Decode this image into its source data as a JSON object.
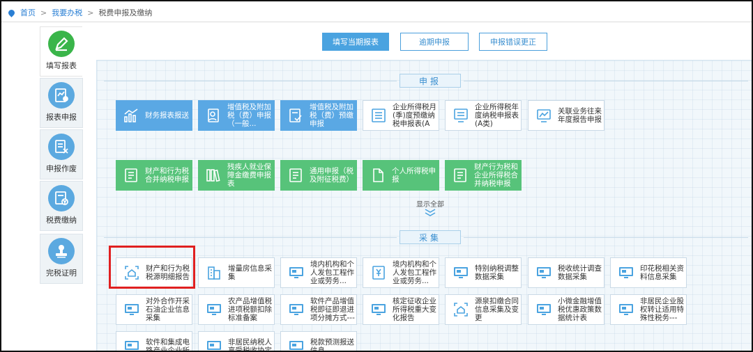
{
  "breadcrumb": {
    "home": "首页",
    "do_tax": "我要办税",
    "current": "税费申报及缴纳",
    "sep": ">"
  },
  "sidebar": [
    {
      "label": "填写报表",
      "icon": "pencil-icon",
      "active": true,
      "color": "#3ab54a"
    },
    {
      "label": "报表申报",
      "icon": "report-upload-icon",
      "active": false,
      "color": "#5ba9e0"
    },
    {
      "label": "申报作废",
      "icon": "doc-cancel-icon",
      "active": false,
      "color": "#5ba9e0"
    },
    {
      "label": "税费缴纳",
      "icon": "tax-payment-icon",
      "active": false,
      "color": "#5ba9e0"
    },
    {
      "label": "完税证明",
      "icon": "stamp-icon",
      "active": false,
      "color": "#5ba9e0"
    }
  ],
  "tabs": [
    {
      "label": "填写当期报表",
      "active": true
    },
    {
      "label": "逾期申报",
      "active": false
    },
    {
      "label": "申报错误更正",
      "active": false
    }
  ],
  "declare": {
    "title": "申报",
    "row1": [
      {
        "label": "财务报表报送",
        "icon": "bar-chart-icon",
        "style": "blue"
      },
      {
        "label": "增值税及附加税（费）申报（一般...",
        "icon": "person-form-icon",
        "style": "blue"
      },
      {
        "label": "增值税及附加税（费）预缴申报",
        "icon": "form-check-icon",
        "style": "blue"
      },
      {
        "label": "企业所得税月(季)度预缴纳税申报表(A类)",
        "icon": "list-icon",
        "style": "white"
      },
      {
        "label": "企业所得税年度纳税申报表(A类)",
        "icon": "monitor-doc-icon",
        "style": "white"
      },
      {
        "label": "关联业务往来年度报告申报",
        "icon": "monitor-chart-icon",
        "style": "white"
      }
    ],
    "row2": [
      {
        "label": "财产和行为税合并纳税申报",
        "icon": "document-icon",
        "style": "green"
      },
      {
        "label": "残疾人就业保障金缴费申报表",
        "icon": "books-icon",
        "style": "green"
      },
      {
        "label": "通用申报（税及附征税费）",
        "icon": "document-icon",
        "style": "green"
      },
      {
        "label": "个人所得税申报",
        "icon": "file-icon",
        "style": "green"
      },
      {
        "label": "财产行为税和企业所得税合并纳税申报",
        "icon": "document-icon",
        "style": "green"
      }
    ],
    "show_all": "显示全部"
  },
  "collect": {
    "title": "采集",
    "row1": [
      {
        "label": "财产和行为税税源明细报告",
        "icon": "house-scan-icon"
      },
      {
        "label": "增量房信息采集",
        "icon": "building-icon"
      },
      {
        "label": "境内机构和个人发包工程作业或劳务...",
        "icon": "monitor-icon"
      },
      {
        "label": "境内机构和个人发包工程作业或劳务...",
        "icon": "yuan-doc-icon"
      },
      {
        "label": "特别纳税调整数据采集",
        "icon": "monitor-icon"
      },
      {
        "label": "税收统计调查数据采集",
        "icon": "monitor-icon"
      },
      {
        "label": "印花税相关资料信息采集",
        "icon": "monitor-icon"
      }
    ],
    "row2": [
      {
        "label": "对外合作开采石油企业信息采集",
        "icon": "monitor-icon"
      },
      {
        "label": "农产品增值税进项税额扣除标准备案",
        "icon": "monitor-icon"
      },
      {
        "label": "软件产品增值税即征即退进项分摊方式---",
        "icon": "monitor-icon"
      },
      {
        "label": "核定征收企业所得税重大变化报告",
        "icon": "monitor-icon"
      },
      {
        "label": "源泉扣缴合同信息采集及变更",
        "icon": "house-scan-icon"
      },
      {
        "label": "小微金融增值税优惠政策数据统计表",
        "icon": "monitor-icon"
      },
      {
        "label": "非居民企业股权转让适用特殊性税务---",
        "icon": "monitor-icon"
      }
    ],
    "row3": [
      {
        "label": "软件和集成电路产业企业所",
        "icon": "monitor-icon"
      },
      {
        "label": "非居民纳税人享受税收协定",
        "icon": "monitor-icon"
      },
      {
        "label": "税款预测报送信息",
        "icon": "monitor-icon"
      }
    ]
  },
  "colors": {
    "accent": "#4aa3e0",
    "green": "#57c37a",
    "blue_tile": "#5aa8e4",
    "highlight": "#e02020"
  }
}
